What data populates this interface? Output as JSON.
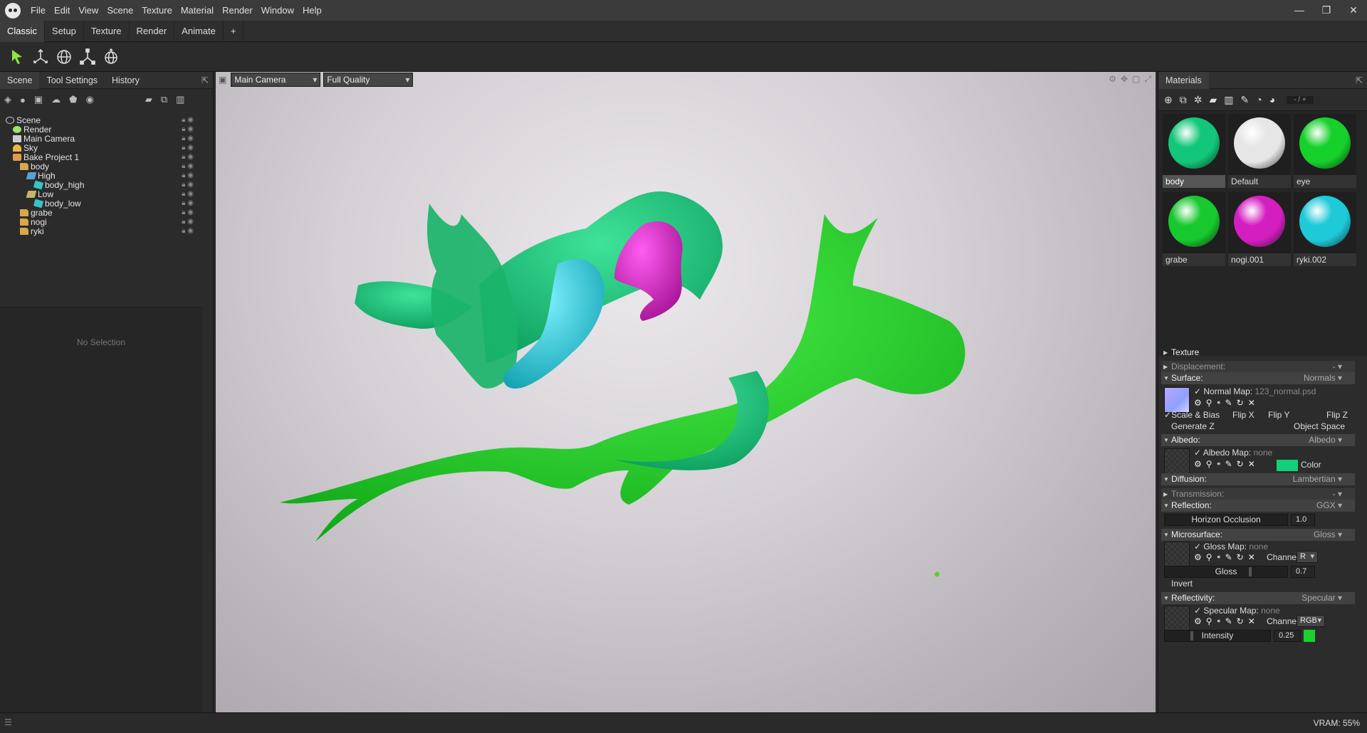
{
  "menubar": {
    "items": [
      "File",
      "Edit",
      "View",
      "Scene",
      "Texture",
      "Material",
      "Render",
      "Window",
      "Help"
    ],
    "window_controls": [
      "—",
      "❐",
      "✕"
    ]
  },
  "workspace_tabs": [
    "Classic",
    "Setup",
    "Texture",
    "Render",
    "Animate",
    "+"
  ],
  "left_panel": {
    "tabs": [
      "Scene",
      "Tool Settings",
      "History"
    ],
    "tree": [
      {
        "label": "Scene",
        "icon": "scene-icon",
        "depth": 0,
        "color": "#cccccc"
      },
      {
        "label": "Render",
        "icon": "render-icon",
        "depth": 1,
        "color": "#9fe36b"
      },
      {
        "label": "Main Camera",
        "icon": "camera-icon",
        "depth": 1,
        "color": "#cccccc"
      },
      {
        "label": "Sky",
        "icon": "sky-icon",
        "depth": 1,
        "color": "#f0b64a"
      },
      {
        "label": "Bake Project 1",
        "icon": "bake-icon",
        "depth": 1,
        "color": "#e39a4a"
      },
      {
        "label": "body",
        "icon": "folder-icon",
        "depth": 2,
        "color": "#d9a84a"
      },
      {
        "label": "High",
        "icon": "mesh-group-icon",
        "depth": 3,
        "color": "#5aa0d8"
      },
      {
        "label": "body_high",
        "icon": "mesh-icon",
        "depth": 4,
        "color": "#37c2c8"
      },
      {
        "label": "Low",
        "icon": "mesh-group-icon",
        "depth": 3,
        "color": "#c9b46a"
      },
      {
        "label": "body_low",
        "icon": "mesh-icon",
        "depth": 4,
        "color": "#37c2c8"
      },
      {
        "label": "grabe",
        "icon": "folder-icon",
        "depth": 2,
        "color": "#d9a84a"
      },
      {
        "label": "nogi",
        "icon": "folder-icon",
        "depth": 2,
        "color": "#d9a84a"
      },
      {
        "label": "ryki",
        "icon": "folder-icon",
        "depth": 2,
        "color": "#d9a84a"
      }
    ],
    "no_selection": "No Selection"
  },
  "viewport": {
    "camera": "Main Camera",
    "quality": "Full Quality"
  },
  "materials_panel": {
    "title": "Materials",
    "counter": "- / +",
    "materials": [
      {
        "name": "body",
        "color": "#13c77a",
        "selected": true
      },
      {
        "name": "Default",
        "color": "#e6e6e6",
        "selected": false
      },
      {
        "name": "eye",
        "color": "#16d12a",
        "selected": false
      },
      {
        "name": "grabe",
        "color": "#18c92e",
        "selected": false
      },
      {
        "name": "nogi.001",
        "color": "#d41ec0",
        "selected": false
      },
      {
        "name": "ryki.002",
        "color": "#1ec9d8",
        "selected": false
      }
    ]
  },
  "properties": {
    "texture": "Texture",
    "displacement": {
      "label": "Displacement:",
      "value": "-"
    },
    "surface": {
      "label": "Surface:",
      "value": "Normals",
      "map_label": "Normal Map:",
      "map_value": "123_normal.psd",
      "scale_bias": "Scale & Bias",
      "flip_x": "Flip X",
      "flip_y": "Flip Y",
      "flip_z": "Flip Z",
      "generate_z": "Generate Z",
      "object_space": "Object Space"
    },
    "albedo": {
      "label": "Albedo:",
      "value": "Albedo",
      "map_label": "Albedo Map:",
      "map_value": "none",
      "color_label": "Color",
      "color": "#12d17a"
    },
    "diffusion": {
      "label": "Diffusion:",
      "value": "Lambertian"
    },
    "transmission": {
      "label": "Transmission:",
      "value": "-"
    },
    "reflection": {
      "label": "Reflection:",
      "value": "GGX",
      "horizon_label": "Horizon Occlusion",
      "horizon_value": "1.0"
    },
    "microsurface": {
      "label": "Microsurface:",
      "value": "Gloss",
      "map_label": "Gloss Map:",
      "map_value": "none",
      "channel_label": "Channel",
      "channel": "R",
      "gloss_label": "Gloss",
      "gloss_value": "0.7",
      "gloss_fraction": 0.7,
      "invert": "Invert"
    },
    "reflectivity": {
      "label": "Reflectivity:",
      "value": "Specular",
      "map_label": "Specular Map:",
      "map_value": "none",
      "channel_label": "Channel",
      "channel": "RGB",
      "intensity_label": "Intensity",
      "intensity_value": "0.25",
      "intensity_fraction": 0.25,
      "swatch": "#19d22d"
    }
  },
  "status": {
    "vram": "VRAM: 55%"
  }
}
